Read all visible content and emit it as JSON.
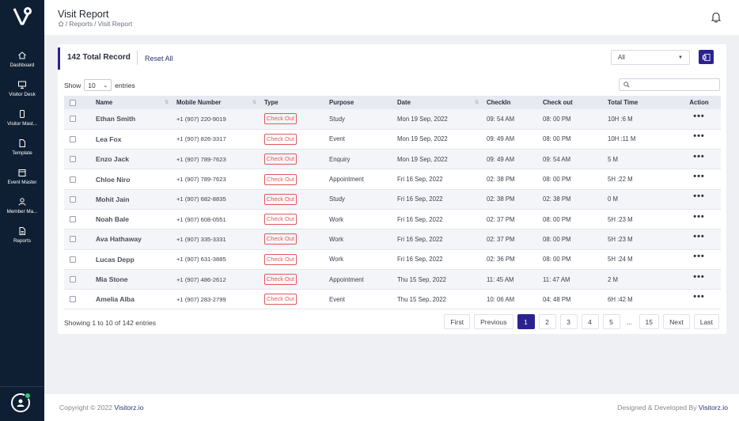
{
  "sidebar": {
    "items": [
      {
        "label": "Dashboard",
        "icon": "home-icon"
      },
      {
        "label": "Visitor Desk",
        "icon": "monitor-icon"
      },
      {
        "label": "Visitor Mast...",
        "icon": "phone-icon"
      },
      {
        "label": "Template",
        "icon": "file-icon"
      },
      {
        "label": "Event Master",
        "icon": "calendar-icon"
      },
      {
        "label": "Member Ma...",
        "icon": "user-icon"
      },
      {
        "label": "Reports",
        "icon": "report-icon"
      }
    ]
  },
  "header": {
    "title": "Visit Report",
    "breadcrumb": [
      "Reports",
      "Visit Report"
    ]
  },
  "toolbar": {
    "total_records": "142 Total Record",
    "reset_label": "Reset All",
    "filter_value": "All"
  },
  "table_controls": {
    "show_label": "Show",
    "page_size": "10",
    "entries_label": "entries"
  },
  "columns": [
    "Name",
    "Mobile Number",
    "Type",
    "Purpose",
    "Date",
    "CheckIn",
    "Check out",
    "Total Time",
    "Action"
  ],
  "rows": [
    {
      "name": "Ethan Smith",
      "mobile": "+1 (907) 220-9019",
      "type": "Check Out",
      "purpose": "Study",
      "date": "Mon 19 Sep, 2022",
      "checkin": "09: 54 AM",
      "checkout": "08: 00 PM",
      "total": "10H :6 M"
    },
    {
      "name": "Lea Fox",
      "mobile": "+1 (907) 826-3317",
      "type": "Check Out",
      "purpose": "Event",
      "date": "Mon 19 Sep, 2022",
      "checkin": "09: 49 AM",
      "checkout": "08: 00 PM",
      "total": "10H :11 M"
    },
    {
      "name": "Enzo Jack",
      "mobile": "+1 (907) 789-7623",
      "type": "Check Out",
      "purpose": "Enquiry",
      "date": "Mon 19 Sep, 2022",
      "checkin": "09: 49 AM",
      "checkout": "09: 54 AM",
      "total": "5 M"
    },
    {
      "name": "Chloe Niro",
      "mobile": "+1 (907) 789-7623",
      "type": "Check Out",
      "purpose": "Appointment",
      "date": "Fri 16 Sep, 2022",
      "checkin": "02: 38 PM",
      "checkout": "08: 00 PM",
      "total": "5H :22 M"
    },
    {
      "name": "Mohit Jain",
      "mobile": "+1 (907) 682-8835",
      "type": "Check Out",
      "purpose": "Study",
      "date": "Fri 16 Sep, 2022",
      "checkin": "02: 38 PM",
      "checkout": "02: 38 PM",
      "total": "0 M"
    },
    {
      "name": "Noah Bale",
      "mobile": "+1 (907) 608-0551",
      "type": "Check Out",
      "purpose": "Work",
      "date": "Fri 16 Sep, 2022",
      "checkin": "02: 37 PM",
      "checkout": "08: 00 PM",
      "total": "5H :23 M"
    },
    {
      "name": "Ava Hathaway",
      "mobile": "+1 (907) 335-3331",
      "type": "Check Out",
      "purpose": "Work",
      "date": "Fri 16 Sep, 2022",
      "checkin": "02: 37 PM",
      "checkout": "08: 00 PM",
      "total": "5H :23 M"
    },
    {
      "name": "Lucas Depp",
      "mobile": "+1 (907) 631-3885",
      "type": "Check Out",
      "purpose": "Work",
      "date": "Fri 16 Sep, 2022",
      "checkin": "02: 36 PM",
      "checkout": "08: 00 PM",
      "total": "5H :24 M"
    },
    {
      "name": "Mia Stone",
      "mobile": "+1 (907) 486-2612",
      "type": "Check Out",
      "purpose": "Appointment",
      "date": "Thu 15 Sep, 2022",
      "checkin": "11: 45 AM",
      "checkout": "11: 47 AM",
      "total": "2 M"
    },
    {
      "name": "Amelia Alba",
      "mobile": "+1 (907) 283-2799",
      "type": "Check Out",
      "purpose": "Event",
      "date": "Thu 15 Sep, 2022",
      "checkin": "10: 06 AM",
      "checkout": "04: 48 PM",
      "total": "6H :42 M"
    }
  ],
  "action_label": "•••",
  "pagination": {
    "summary": "Showing 1 to 10 of 142 entries",
    "first": "First",
    "previous": "Previous",
    "pages": [
      "1",
      "2",
      "3",
      "4",
      "5"
    ],
    "ellipsis": "...",
    "last_page": "15",
    "next": "Next",
    "last": "Last"
  },
  "footer": {
    "copyright": "Copyright © 2022 ",
    "brand": "Visitorz.io",
    "designed": "Designed & Developed By "
  },
  "colors": {
    "sidebar_bg": "#0f1f33",
    "accent": "#2b2290",
    "badge": "#e05a5a",
    "online": "#2ecc71"
  }
}
